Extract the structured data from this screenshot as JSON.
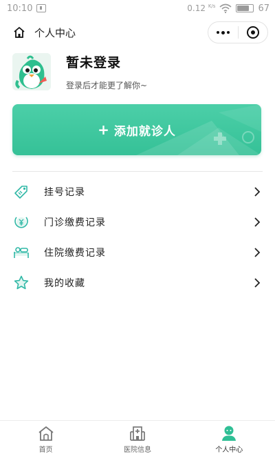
{
  "status_bar": {
    "time": "10:10",
    "speed": "0.12",
    "speed_unit": "K/s",
    "battery": "67",
    "battery_fraction": 0.67
  },
  "nav": {
    "title": "个人中心",
    "home_icon": "home-icon",
    "more_icon": "more-dots-icon",
    "close_icon": "target-icon"
  },
  "profile": {
    "name": "暂未登录",
    "subtitle": "登录后才能更了解你~",
    "avatar_icon": "bird-mascot-icon"
  },
  "add_card": {
    "label": "添加就诊人",
    "plus": "+",
    "color": "#3cc79d"
  },
  "menu": {
    "items": [
      {
        "label": "挂号记录",
        "icon": "tag-icon"
      },
      {
        "label": "门诊缴费记录",
        "icon": "yen-coin-icon"
      },
      {
        "label": "住院缴费记录",
        "icon": "bed-icon"
      },
      {
        "label": "我的收藏",
        "icon": "star-icon"
      }
    ]
  },
  "tabs": {
    "items": [
      {
        "label": "首页",
        "icon": "home-tab-icon",
        "active": false
      },
      {
        "label": "医院信息",
        "icon": "hospital-icon",
        "active": false
      },
      {
        "label": "个人中心",
        "icon": "user-icon",
        "active": true
      }
    ]
  },
  "colors": {
    "accent": "#3cc79d",
    "icon_teal": "#2fb8a6"
  }
}
